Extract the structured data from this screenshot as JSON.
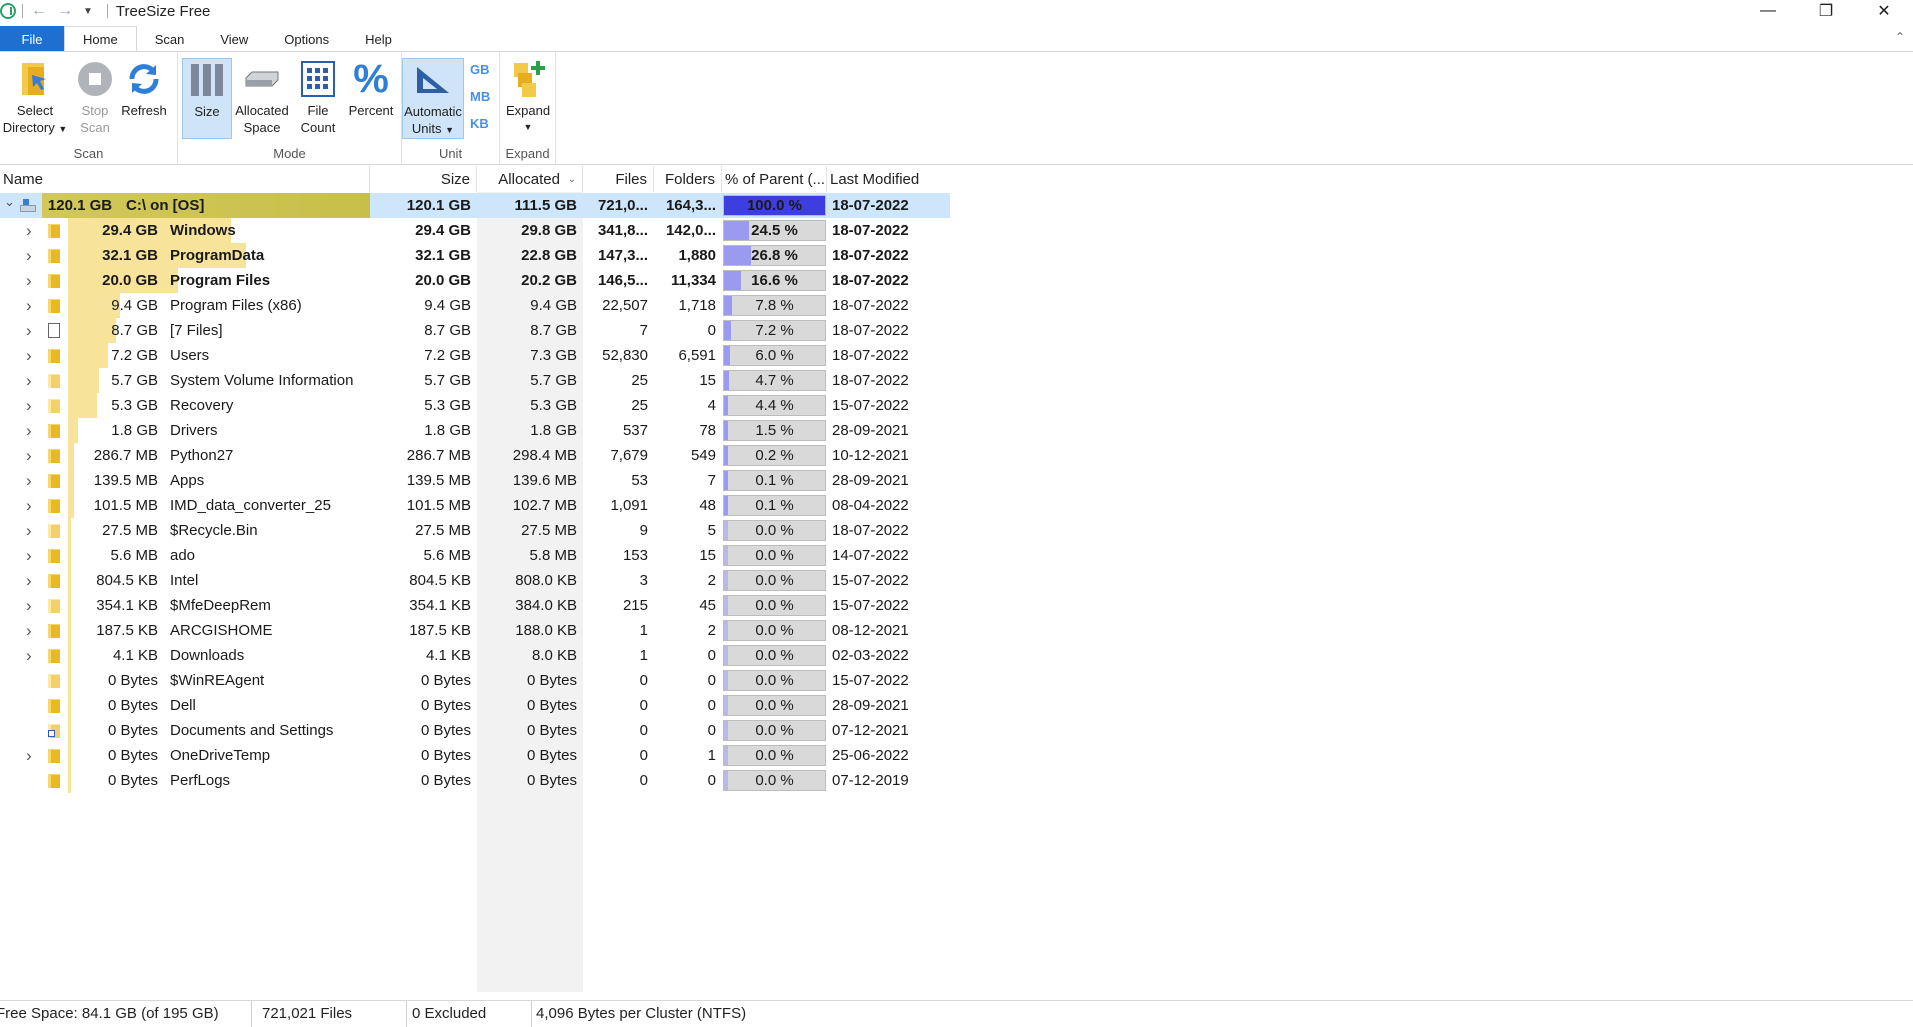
{
  "window": {
    "title": "TreeSize Free",
    "controls": [
      "minimize",
      "restore",
      "close"
    ]
  },
  "quick_access": [
    "back-arrow-icon",
    "forward-arrow-icon",
    "customize-dropdown-icon"
  ],
  "tabs": [
    {
      "label": "File"
    },
    {
      "label": "Home"
    },
    {
      "label": "Scan"
    },
    {
      "label": "View"
    },
    {
      "label": "Options"
    },
    {
      "label": "Help"
    }
  ],
  "ribbon": {
    "scan": {
      "label": "Scan",
      "select_directory": "Select",
      "select_directory_2": "Directory",
      "stop_scan": "Stop",
      "stop_scan_2": "Scan",
      "refresh": "Refresh"
    },
    "mode": {
      "label": "Mode",
      "size": "Size",
      "allocated": "Allocated",
      "allocated_2": "Space",
      "file_count": "File",
      "file_count_2": "Count",
      "percent": "Percent"
    },
    "unit": {
      "label": "Unit",
      "automatic": "Automatic",
      "automatic_2": "Units",
      "gb": "GB",
      "mb": "MB",
      "kb": "KB"
    },
    "expand": {
      "label": "Expand",
      "expand": "Expand"
    }
  },
  "columns": {
    "name": "Name",
    "size": "Size",
    "allocated": "Allocated",
    "files": "Files",
    "folders": "Folders",
    "percent": "% of Parent (...",
    "modified": "Last Modified"
  },
  "rows": [
    {
      "badge": "120.1 GB",
      "name": "C:\\  on  [OS]",
      "size": "120.1 GB",
      "allocated": "111.5 GB",
      "files": "721,0...",
      "folders": "164,3...",
      "percent": "100.0 %",
      "pct": 100,
      "modified": "18-07-2022",
      "bold": true,
      "icon": "drive",
      "expander": "expanded"
    },
    {
      "badge": "29.4 GB",
      "name": "Windows",
      "size": "29.4 GB",
      "allocated": "29.8 GB",
      "files": "341,8...",
      "folders": "142,0...",
      "percent": "24.5 %",
      "pct": 24.5,
      "modified": "18-07-2022",
      "bold": true,
      "icon": "folder",
      "expander": "collapsed"
    },
    {
      "badge": "32.1 GB",
      "name": "ProgramData",
      "size": "32.1 GB",
      "allocated": "22.8 GB",
      "files": "147,3...",
      "folders": "1,880",
      "percent": "26.8 %",
      "pct": 26.8,
      "modified": "18-07-2022",
      "bold": true,
      "icon": "folder",
      "expander": "collapsed"
    },
    {
      "badge": "20.0 GB",
      "name": "Program Files",
      "size": "20.0 GB",
      "allocated": "20.2 GB",
      "files": "146,5...",
      "folders": "11,334",
      "percent": "16.6 %",
      "pct": 16.6,
      "modified": "18-07-2022",
      "bold": true,
      "icon": "folder",
      "expander": "collapsed"
    },
    {
      "badge": "9.4 GB",
      "name": "Program Files (x86)",
      "size": "9.4 GB",
      "allocated": "9.4 GB",
      "files": "22,507",
      "folders": "1,718",
      "percent": "7.8 %",
      "pct": 7.8,
      "modified": "18-07-2022",
      "bold": false,
      "icon": "folder",
      "expander": "collapsed"
    },
    {
      "badge": "8.7 GB",
      "name": "[7 Files]",
      "size": "8.7 GB",
      "allocated": "8.7 GB",
      "files": "7",
      "folders": "0",
      "percent": "7.2 %",
      "pct": 7.2,
      "modified": "18-07-2022",
      "bold": false,
      "icon": "file",
      "expander": "collapsed"
    },
    {
      "badge": "7.2 GB",
      "name": "Users",
      "size": "7.2 GB",
      "allocated": "7.3 GB",
      "files": "52,830",
      "folders": "6,591",
      "percent": "6.0 %",
      "pct": 6.0,
      "modified": "18-07-2022",
      "bold": false,
      "icon": "folder",
      "expander": "collapsed"
    },
    {
      "badge": "5.7 GB",
      "name": "System Volume Information",
      "size": "5.7 GB",
      "allocated": "5.7 GB",
      "files": "25",
      "folders": "15",
      "percent": "4.7 %",
      "pct": 4.7,
      "modified": "18-07-2022",
      "bold": false,
      "icon": "folder-light",
      "expander": "collapsed"
    },
    {
      "badge": "5.3 GB",
      "name": "Recovery",
      "size": "5.3 GB",
      "allocated": "5.3 GB",
      "files": "25",
      "folders": "4",
      "percent": "4.4 %",
      "pct": 4.4,
      "modified": "15-07-2022",
      "bold": false,
      "icon": "folder-light",
      "expander": "collapsed"
    },
    {
      "badge": "1.8 GB",
      "name": "Drivers",
      "size": "1.8 GB",
      "allocated": "1.8 GB",
      "files": "537",
      "folders": "78",
      "percent": "1.5 %",
      "pct": 1.5,
      "modified": "28-09-2021",
      "bold": false,
      "icon": "folder",
      "expander": "collapsed"
    },
    {
      "badge": "286.7 MB",
      "name": "Python27",
      "size": "286.7 MB",
      "allocated": "298.4 MB",
      "files": "7,679",
      "folders": "549",
      "percent": "0.2 %",
      "pct": 0.2,
      "modified": "10-12-2021",
      "bold": false,
      "icon": "folder",
      "expander": "collapsed"
    },
    {
      "badge": "139.5 MB",
      "name": "Apps",
      "size": "139.5 MB",
      "allocated": "139.6 MB",
      "files": "53",
      "folders": "7",
      "percent": "0.1 %",
      "pct": 0.1,
      "modified": "28-09-2021",
      "bold": false,
      "icon": "folder",
      "expander": "collapsed"
    },
    {
      "badge": "101.5 MB",
      "name": "IMD_data_converter_25",
      "size": "101.5 MB",
      "allocated": "102.7 MB",
      "files": "1,091",
      "folders": "48",
      "percent": "0.1 %",
      "pct": 0.1,
      "modified": "08-04-2022",
      "bold": false,
      "icon": "folder",
      "expander": "collapsed"
    },
    {
      "badge": "27.5 MB",
      "name": "$Recycle.Bin",
      "size": "27.5 MB",
      "allocated": "27.5 MB",
      "files": "9",
      "folders": "5",
      "percent": "0.0 %",
      "pct": 0,
      "modified": "18-07-2022",
      "bold": false,
      "icon": "folder-light",
      "expander": "collapsed"
    },
    {
      "badge": "5.6 MB",
      "name": "ado",
      "size": "5.6 MB",
      "allocated": "5.8 MB",
      "files": "153",
      "folders": "15",
      "percent": "0.0 %",
      "pct": 0,
      "modified": "14-07-2022",
      "bold": false,
      "icon": "folder",
      "expander": "collapsed"
    },
    {
      "badge": "804.5 KB",
      "name": "Intel",
      "size": "804.5 KB",
      "allocated": "808.0 KB",
      "files": "3",
      "folders": "2",
      "percent": "0.0 %",
      "pct": 0,
      "modified": "15-07-2022",
      "bold": false,
      "icon": "folder",
      "expander": "collapsed"
    },
    {
      "badge": "354.1 KB",
      "name": "$MfeDeepRem",
      "size": "354.1 KB",
      "allocated": "384.0 KB",
      "files": "215",
      "folders": "45",
      "percent": "0.0 %",
      "pct": 0,
      "modified": "15-07-2022",
      "bold": false,
      "icon": "folder-light",
      "expander": "collapsed"
    },
    {
      "badge": "187.5 KB",
      "name": "ARCGISHOME",
      "size": "187.5 KB",
      "allocated": "188.0 KB",
      "files": "1",
      "folders": "2",
      "percent": "0.0 %",
      "pct": 0,
      "modified": "08-12-2021",
      "bold": false,
      "icon": "folder",
      "expander": "collapsed"
    },
    {
      "badge": "4.1 KB",
      "name": "Downloads",
      "size": "4.1 KB",
      "allocated": "8.0 KB",
      "files": "1",
      "folders": "0",
      "percent": "0.0 %",
      "pct": 0,
      "modified": "02-03-2022",
      "bold": false,
      "icon": "folder",
      "expander": "collapsed"
    },
    {
      "badge": "0 Bytes",
      "name": "$WinREAgent",
      "size": "0 Bytes",
      "allocated": "0 Bytes",
      "files": "0",
      "folders": "0",
      "percent": "0.0 %",
      "pct": 0,
      "modified": "15-07-2022",
      "bold": false,
      "icon": "folder-light",
      "expander": "none"
    },
    {
      "badge": "0 Bytes",
      "name": "Dell",
      "size": "0 Bytes",
      "allocated": "0 Bytes",
      "files": "0",
      "folders": "0",
      "percent": "0.0 %",
      "pct": 0,
      "modified": "28-09-2021",
      "bold": false,
      "icon": "folder",
      "expander": "none"
    },
    {
      "badge": "0 Bytes",
      "name": "Documents and Settings",
      "size": "0 Bytes",
      "allocated": "0 Bytes",
      "files": "0",
      "folders": "0",
      "percent": "0.0 %",
      "pct": 0,
      "modified": "07-12-2021",
      "bold": false,
      "icon": "folder-link",
      "expander": "none"
    },
    {
      "badge": "0 Bytes",
      "name": "OneDriveTemp",
      "size": "0 Bytes",
      "allocated": "0 Bytes",
      "files": "0",
      "folders": "1",
      "percent": "0.0 %",
      "pct": 0,
      "modified": "25-06-2022",
      "bold": false,
      "icon": "folder",
      "expander": "collapsed"
    },
    {
      "badge": "0 Bytes",
      "name": "PerfLogs",
      "size": "0 Bytes",
      "allocated": "0 Bytes",
      "files": "0",
      "folders": "0",
      "percent": "0.0 %",
      "pct": 0,
      "modified": "07-12-2019",
      "bold": false,
      "icon": "folder",
      "expander": "none"
    }
  ],
  "status": {
    "free_space": "Free Space: 84.1 GB  (of 195 GB)",
    "files": "721,021 Files",
    "excluded": "0 Excluded",
    "cluster": "4,096 Bytes per Cluster (NTFS)"
  },
  "colors": {
    "file_tab": "#1f6fd1",
    "selected_row": "#cde6fb",
    "size_bar": "#f7e39a",
    "size_bar_root": "#d2c85a",
    "percent_fill": "#9a9af0",
    "percent_fill_root": "#3d3de0"
  }
}
